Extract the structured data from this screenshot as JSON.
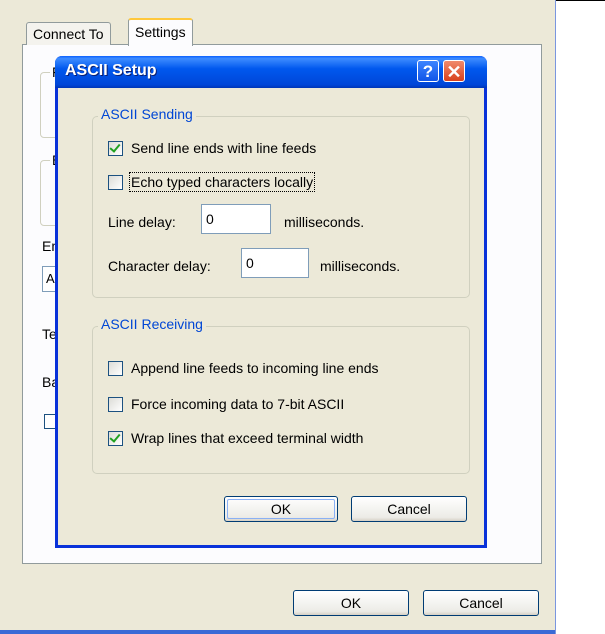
{
  "parent": {
    "tabs": [
      {
        "label": "Connect To"
      },
      {
        "label": "Settings"
      }
    ],
    "fragments": {
      "f": "F",
      "e": "E",
      "em": "Em",
      "an": "AN",
      "tel": "Tel",
      "bac": "Bac"
    },
    "ok_label": "OK",
    "cancel_label": "Cancel"
  },
  "dialog": {
    "title": "ASCII Setup",
    "help_label": "?",
    "close_label": "✕",
    "sending": {
      "legend": "ASCII Sending",
      "send_line_ends": {
        "label": "Send line ends with line feeds",
        "checked": true
      },
      "echo_typed": {
        "label": "Echo typed characters locally",
        "checked": false
      },
      "line_delay": {
        "label": "Line delay:",
        "value": "0",
        "unit": "milliseconds."
      },
      "char_delay": {
        "label": "Character delay:",
        "value": "0",
        "unit": "milliseconds."
      }
    },
    "receiving": {
      "legend": "ASCII Receiving",
      "append_line_feeds": {
        "label": "Append line feeds to incoming line ends",
        "checked": false
      },
      "force_7bit": {
        "label": "Force incoming data to 7-bit ASCII",
        "checked": false
      },
      "wrap_lines": {
        "label": "Wrap lines that exceed terminal width",
        "checked": true
      }
    },
    "ok_label": "OK",
    "cancel_label": "Cancel"
  },
  "colors": {
    "title_bar": "#0054e3",
    "legend_text": "#0046d5",
    "dialog_face": "#ece9d8"
  }
}
